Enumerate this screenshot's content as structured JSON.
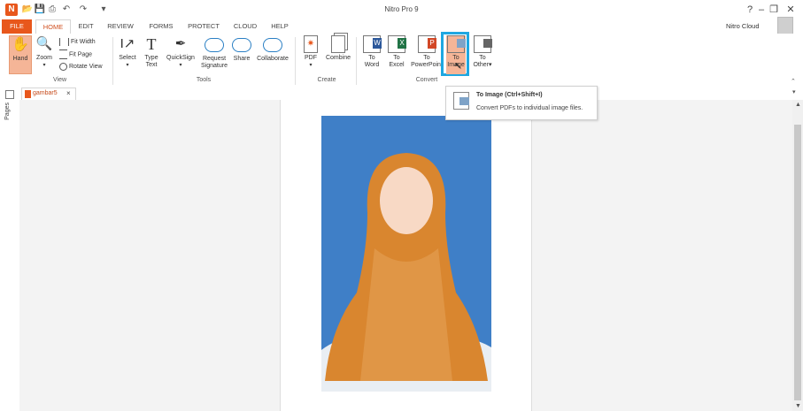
{
  "app": {
    "title": "Nitro Pro 9",
    "account": "Nitro Cloud"
  },
  "tabs": [
    "FILE",
    "HOME",
    "EDIT",
    "REVIEW",
    "FORMS",
    "PROTECT",
    "CLOUD",
    "HELP"
  ],
  "ribbon": {
    "view": {
      "hand": "Hand",
      "zoom": "Zoom",
      "fit_width": "Fit Width",
      "fit_page": "Fit Page",
      "rotate_view": "Rotate View",
      "label": "View"
    },
    "tools": {
      "select": "Select",
      "type_text_1": "Type",
      "type_text_2": "Text",
      "quicksign": "QuickSign",
      "request_signature_1": "Request",
      "request_signature_2": "Signature",
      "share": "Share",
      "collaborate": "Collaborate",
      "label": "Tools"
    },
    "create": {
      "pdf": "PDF",
      "combine": "Combine",
      "label": "Create"
    },
    "convert": {
      "to_word_1": "To",
      "to_word_2": "Word",
      "to_excel_1": "To",
      "to_excel_2": "Excel",
      "to_ppt_1": "To",
      "to_ppt_2": "PowerPoint",
      "to_image_1": "To",
      "to_image_2": "Image",
      "to_other_1": "To",
      "to_other_2": "Other",
      "label": "Convert"
    }
  },
  "sidebar": {
    "pages": "Pages"
  },
  "document": {
    "tab_name": "gambar5"
  },
  "tooltip": {
    "title": "To Image (Ctrl+Shift+I)",
    "description": "Convert PDFs to individual image files."
  },
  "colors": {
    "accent": "#e8571c",
    "highlight": "#1ea7e1",
    "photo_bg": "#3f7fc7",
    "hijab": "#d9862f"
  }
}
